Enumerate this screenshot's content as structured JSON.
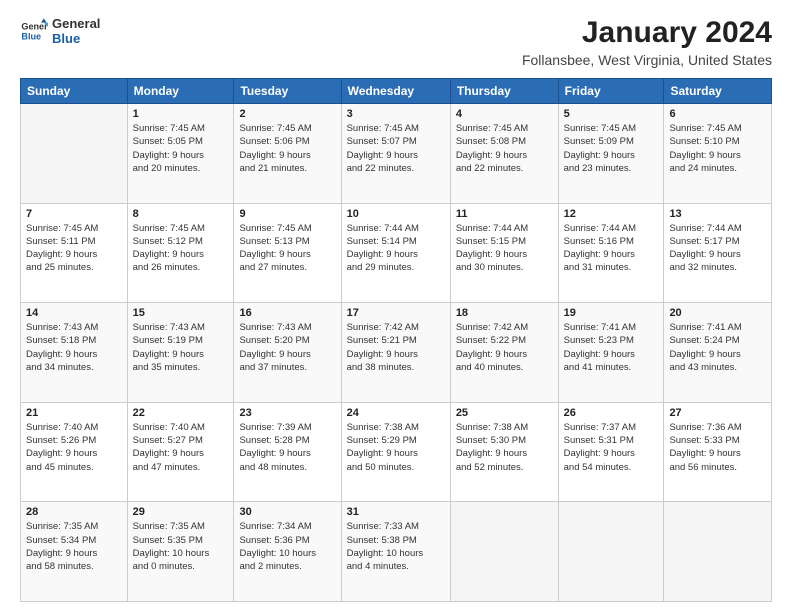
{
  "logo": {
    "line1": "General",
    "line2": "Blue"
  },
  "header": {
    "month": "January 2024",
    "location": "Follansbee, West Virginia, United States"
  },
  "weekdays": [
    "Sunday",
    "Monday",
    "Tuesday",
    "Wednesday",
    "Thursday",
    "Friday",
    "Saturday"
  ],
  "weeks": [
    [
      {
        "day": "",
        "detail": ""
      },
      {
        "day": "1",
        "detail": "Sunrise: 7:45 AM\nSunset: 5:05 PM\nDaylight: 9 hours\nand 20 minutes."
      },
      {
        "day": "2",
        "detail": "Sunrise: 7:45 AM\nSunset: 5:06 PM\nDaylight: 9 hours\nand 21 minutes."
      },
      {
        "day": "3",
        "detail": "Sunrise: 7:45 AM\nSunset: 5:07 PM\nDaylight: 9 hours\nand 22 minutes."
      },
      {
        "day": "4",
        "detail": "Sunrise: 7:45 AM\nSunset: 5:08 PM\nDaylight: 9 hours\nand 22 minutes."
      },
      {
        "day": "5",
        "detail": "Sunrise: 7:45 AM\nSunset: 5:09 PM\nDaylight: 9 hours\nand 23 minutes."
      },
      {
        "day": "6",
        "detail": "Sunrise: 7:45 AM\nSunset: 5:10 PM\nDaylight: 9 hours\nand 24 minutes."
      }
    ],
    [
      {
        "day": "7",
        "detail": "Sunrise: 7:45 AM\nSunset: 5:11 PM\nDaylight: 9 hours\nand 25 minutes."
      },
      {
        "day": "8",
        "detail": "Sunrise: 7:45 AM\nSunset: 5:12 PM\nDaylight: 9 hours\nand 26 minutes."
      },
      {
        "day": "9",
        "detail": "Sunrise: 7:45 AM\nSunset: 5:13 PM\nDaylight: 9 hours\nand 27 minutes."
      },
      {
        "day": "10",
        "detail": "Sunrise: 7:44 AM\nSunset: 5:14 PM\nDaylight: 9 hours\nand 29 minutes."
      },
      {
        "day": "11",
        "detail": "Sunrise: 7:44 AM\nSunset: 5:15 PM\nDaylight: 9 hours\nand 30 minutes."
      },
      {
        "day": "12",
        "detail": "Sunrise: 7:44 AM\nSunset: 5:16 PM\nDaylight: 9 hours\nand 31 minutes."
      },
      {
        "day": "13",
        "detail": "Sunrise: 7:44 AM\nSunset: 5:17 PM\nDaylight: 9 hours\nand 32 minutes."
      }
    ],
    [
      {
        "day": "14",
        "detail": "Sunrise: 7:43 AM\nSunset: 5:18 PM\nDaylight: 9 hours\nand 34 minutes."
      },
      {
        "day": "15",
        "detail": "Sunrise: 7:43 AM\nSunset: 5:19 PM\nDaylight: 9 hours\nand 35 minutes."
      },
      {
        "day": "16",
        "detail": "Sunrise: 7:43 AM\nSunset: 5:20 PM\nDaylight: 9 hours\nand 37 minutes."
      },
      {
        "day": "17",
        "detail": "Sunrise: 7:42 AM\nSunset: 5:21 PM\nDaylight: 9 hours\nand 38 minutes."
      },
      {
        "day": "18",
        "detail": "Sunrise: 7:42 AM\nSunset: 5:22 PM\nDaylight: 9 hours\nand 40 minutes."
      },
      {
        "day": "19",
        "detail": "Sunrise: 7:41 AM\nSunset: 5:23 PM\nDaylight: 9 hours\nand 41 minutes."
      },
      {
        "day": "20",
        "detail": "Sunrise: 7:41 AM\nSunset: 5:24 PM\nDaylight: 9 hours\nand 43 minutes."
      }
    ],
    [
      {
        "day": "21",
        "detail": "Sunrise: 7:40 AM\nSunset: 5:26 PM\nDaylight: 9 hours\nand 45 minutes."
      },
      {
        "day": "22",
        "detail": "Sunrise: 7:40 AM\nSunset: 5:27 PM\nDaylight: 9 hours\nand 47 minutes."
      },
      {
        "day": "23",
        "detail": "Sunrise: 7:39 AM\nSunset: 5:28 PM\nDaylight: 9 hours\nand 48 minutes."
      },
      {
        "day": "24",
        "detail": "Sunrise: 7:38 AM\nSunset: 5:29 PM\nDaylight: 9 hours\nand 50 minutes."
      },
      {
        "day": "25",
        "detail": "Sunrise: 7:38 AM\nSunset: 5:30 PM\nDaylight: 9 hours\nand 52 minutes."
      },
      {
        "day": "26",
        "detail": "Sunrise: 7:37 AM\nSunset: 5:31 PM\nDaylight: 9 hours\nand 54 minutes."
      },
      {
        "day": "27",
        "detail": "Sunrise: 7:36 AM\nSunset: 5:33 PM\nDaylight: 9 hours\nand 56 minutes."
      }
    ],
    [
      {
        "day": "28",
        "detail": "Sunrise: 7:35 AM\nSunset: 5:34 PM\nDaylight: 9 hours\nand 58 minutes."
      },
      {
        "day": "29",
        "detail": "Sunrise: 7:35 AM\nSunset: 5:35 PM\nDaylight: 10 hours\nand 0 minutes."
      },
      {
        "day": "30",
        "detail": "Sunrise: 7:34 AM\nSunset: 5:36 PM\nDaylight: 10 hours\nand 2 minutes."
      },
      {
        "day": "31",
        "detail": "Sunrise: 7:33 AM\nSunset: 5:38 PM\nDaylight: 10 hours\nand 4 minutes."
      },
      {
        "day": "",
        "detail": ""
      },
      {
        "day": "",
        "detail": ""
      },
      {
        "day": "",
        "detail": ""
      }
    ]
  ]
}
